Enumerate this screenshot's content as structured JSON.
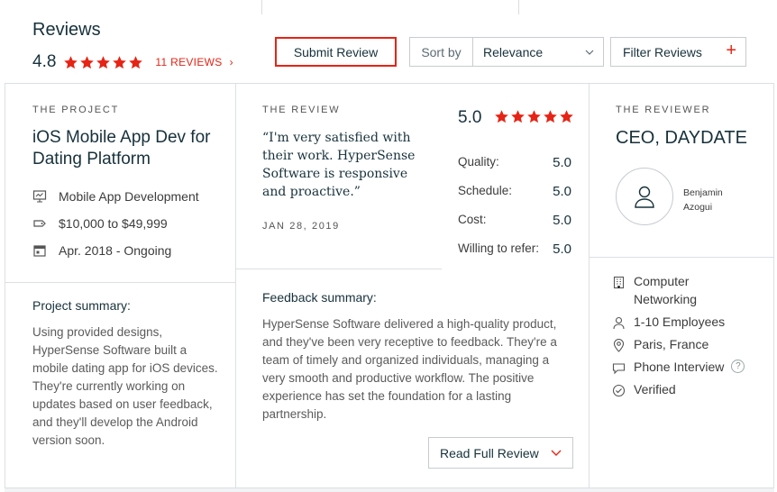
{
  "header": {
    "title": "Reviews",
    "rating": "4.8",
    "reviews_count": "11 REVIEWS",
    "reviews_chevron": "›",
    "submit_label": "Submit Review",
    "sort_label": "Sort by",
    "sort_value": "Relevance",
    "filter_label": "Filter Reviews",
    "filter_plus": "+",
    "accent_color": "#e62415",
    "star_count": 5
  },
  "project": {
    "section_label": "THE PROJECT",
    "title": "iOS Mobile App Dev for Dating Platform",
    "service": "Mobile App Development",
    "budget": "$10,000 to $49,999",
    "dates": "Apr. 2018 - Ongoing",
    "summary_heading": "Project summary:",
    "summary_text": "Using provided designs, HyperSense Software built a mobile dating app for iOS devices. They're currently working on updates based on user feedback, and they'll develop the Android version soon.",
    "icons": [
      "presentation-icon",
      "price-tag-icon",
      "calendar-icon"
    ]
  },
  "review": {
    "section_label": "THE REVIEW",
    "quote": "“I'm very satisfied with their work. HyperSense Software is responsive and proactive.”",
    "date": "JAN 28, 2019",
    "overall": "5.0",
    "scores": [
      {
        "label": "Quality:",
        "value": "5.0"
      },
      {
        "label": "Schedule:",
        "value": "5.0"
      },
      {
        "label": "Cost:",
        "value": "5.0"
      },
      {
        "label": "Willing to refer:",
        "value": "5.0"
      }
    ],
    "feedback_heading": "Feedback summary:",
    "feedback_text": "HyperSense Software delivered a high-quality product, and they've been very receptive to feedback. They're a team of timely and organized individuals, managing a very smooth and productive workflow. The positive experience has set the foundation for a lasting partnership.",
    "read_full_label": "Read Full Review"
  },
  "reviewer": {
    "section_label": "THE REVIEWER",
    "title": "CEO, DAYDATE",
    "name": "Benjamin Azogui",
    "industry": "Computer Networking",
    "size": "1-10 Employees",
    "location": "Paris, France",
    "interview": "Phone Interview",
    "help": "?",
    "verified": "Verified",
    "icons": [
      "building-icon",
      "person-icon",
      "location-pin-icon",
      "chat-bubble-icon",
      "check-circle-icon"
    ]
  }
}
